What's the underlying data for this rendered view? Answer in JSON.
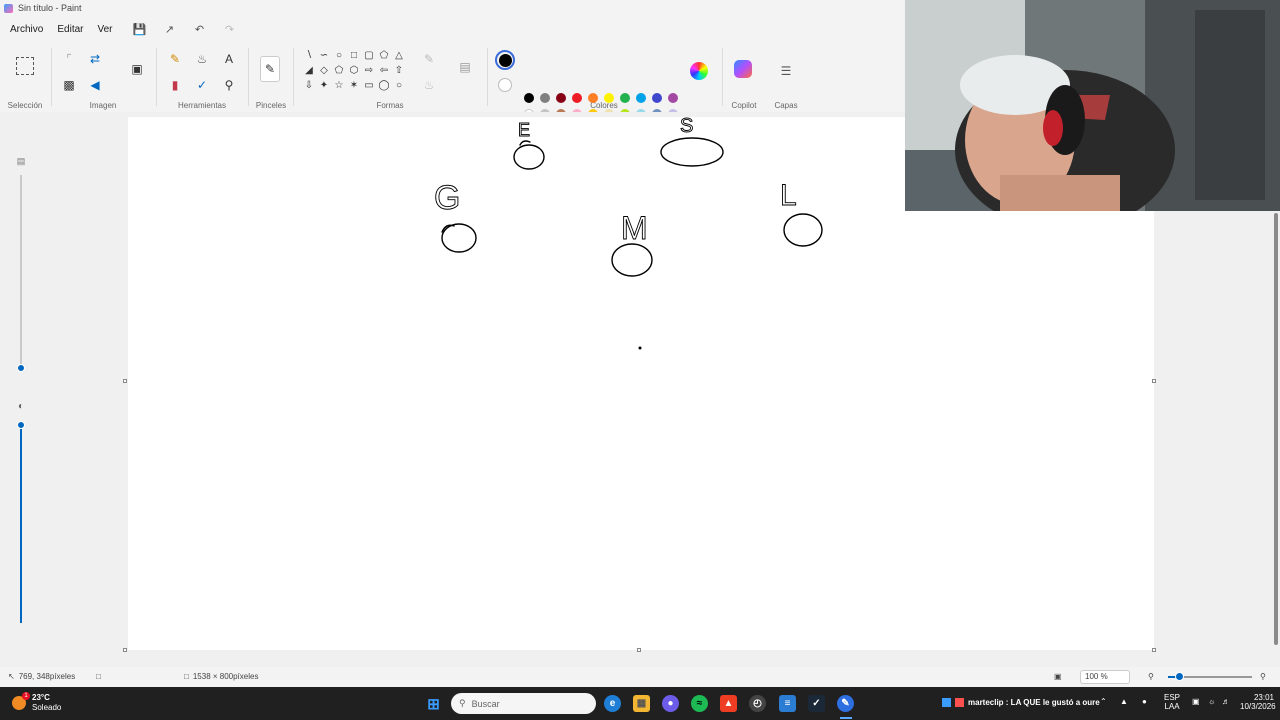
{
  "window": {
    "title": "Sin título - Paint"
  },
  "menu": {
    "items": [
      "Archivo",
      "Editar",
      "Ver"
    ]
  },
  "ribbon": {
    "groups": {
      "seleccion": "Selección",
      "imagen": "Imagen",
      "herramientas": "Herramientas",
      "pinceles": "Pinceles",
      "formas": "Formas",
      "colores": "Colores",
      "copilot": "Copilot",
      "capas": "Capas"
    },
    "palette": {
      "row1": [
        "#000000",
        "#7f7f7f",
        "#880015",
        "#ed1c24",
        "#ff7f27",
        "#fff200",
        "#22b14c",
        "#00a2e8",
        "#3f48cc",
        "#a349a4"
      ],
      "row2": [
        "#ffffff",
        "#c3c3c3",
        "#b97a57",
        "#ffaec9",
        "#ffc90e",
        "#efe4b0",
        "#b5e61d",
        "#99d9ea",
        "#7092be",
        "#c8bfe7"
      ]
    },
    "active_color": "#000000"
  },
  "canvas": {
    "sketch_labels": [
      "E",
      "S",
      "G",
      "M",
      "L"
    ]
  },
  "statusbar": {
    "cursor_position": "769, 348píxeles",
    "canvas_size": "1538 × 800píxeles",
    "zoom": "100 %"
  },
  "taskbar": {
    "weather_temp": "23°C",
    "weather_desc": "Soleado",
    "search_placeholder": "Buscar",
    "notification": "marteclip : LA QUE le gustó a oure",
    "lang_top": "ESP",
    "lang_bottom": "LAA",
    "time": "23:01",
    "date": "10/3/2026"
  }
}
